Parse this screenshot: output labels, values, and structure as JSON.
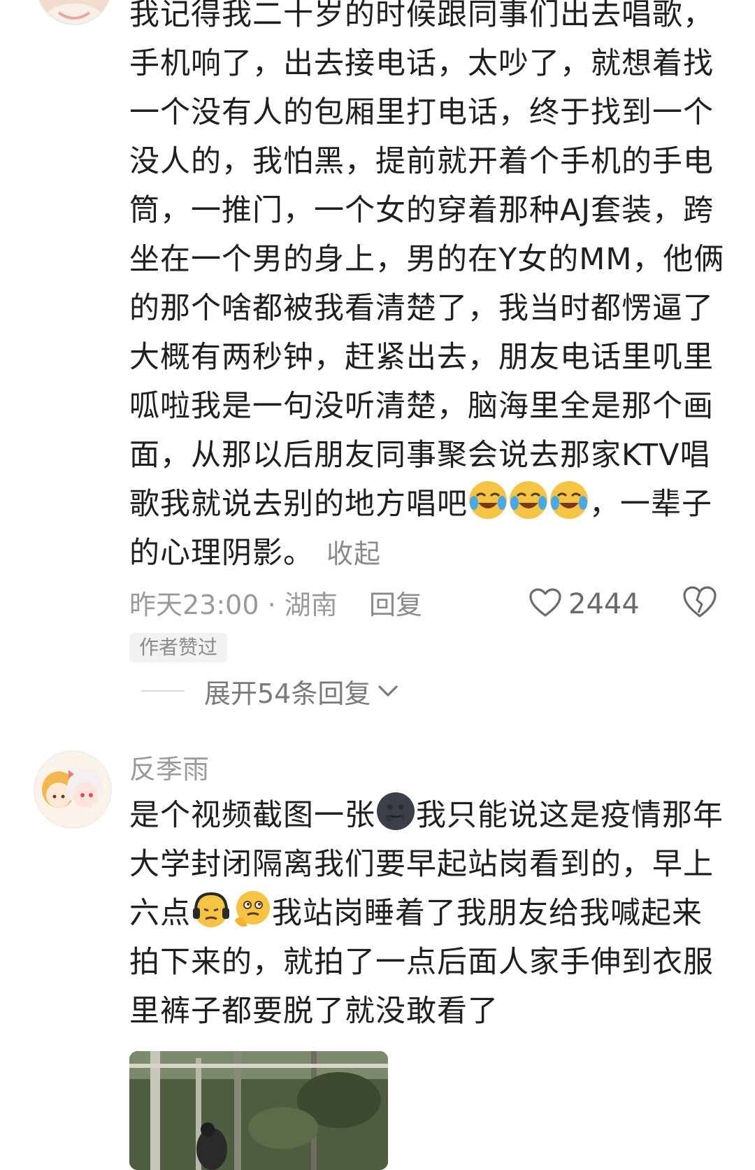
{
  "comments": [
    {
      "text_a": "我记得我二十岁的时候跟同事们出去唱歌，手机响了，出去接电话，太吵了，就想着找一个没有人的包厢里打电话，终于找到一个没人的，我怕黑，提前就开着个手机的手电筒，一推门，一个女的穿着那种AJ套装，跨坐在一个男的身上，男的在Y女的MM，他俩的那个啥都被我看清楚了，我当时都愣逼了大概有两秒钟，赶紧出去，朋友电话里叽里呱啦我是一句没听清楚，脑海里全是那个画面，从那以后朋友同事聚会说去那家KTV唱歌我就说去别的地方唱吧",
      "emojis_a": [
        "crying-laugh",
        "crying-laugh",
        "crying-laugh"
      ],
      "text_b": "，一辈子的心理阴影。",
      "collapse_label": "收起",
      "time": "昨天23:00",
      "separator": "·",
      "location": "湖南",
      "reply_label": "回复",
      "like_count": "2444",
      "author_tag": "作者赞过",
      "expand_label": "展开54条回复"
    },
    {
      "username": "反季雨",
      "text_a": "是个视频截图一张",
      "emoji_a": "dark-moon",
      "text_b": "我只能说这是疫情那年大学封闭隔离我们要早起站岗看到的，早上六点",
      "emoji_b1": "headphones-face",
      "emoji_b2": "thinking-face",
      "text_c": "我站岗睡着了我朋友给我喊起来拍下来的，就拍了一点后面人家手伸到衣服里裤子都要脱了就没敢看了"
    }
  ],
  "colors": {
    "text": "#1f1f1f",
    "meta": "#9a9a9a",
    "muted": "#8a8a8a",
    "emoji_yellow": "#f6c445"
  }
}
